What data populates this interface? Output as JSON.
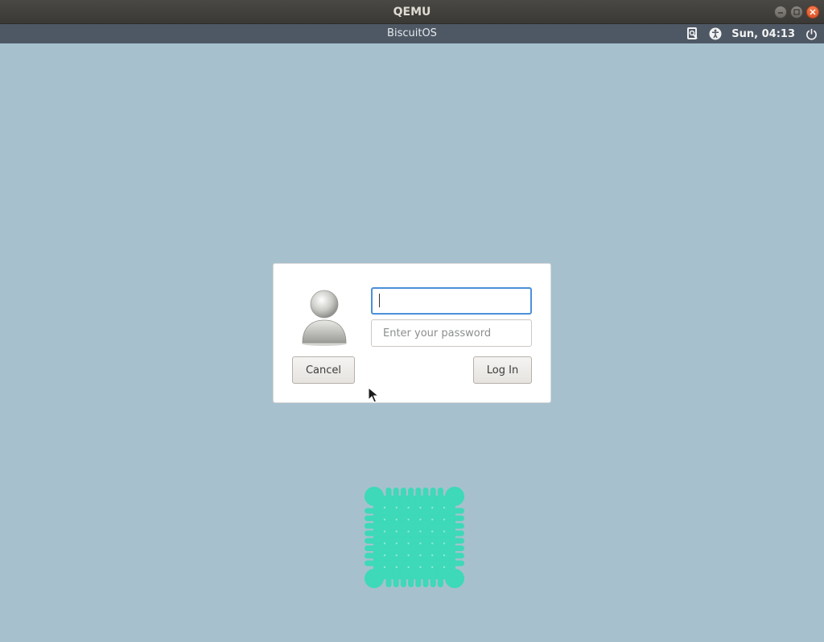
{
  "window": {
    "title": "QEMU",
    "buttons": [
      "minimize",
      "maximize",
      "close"
    ]
  },
  "topbar": {
    "hostname": "BiscuitOS",
    "clock": "Sun, 04:13",
    "icons": [
      "screen-reader-icon",
      "accessibility-icon",
      "power-icon"
    ]
  },
  "login": {
    "username_value": "",
    "password_placeholder": "Enter your password",
    "cancel_label": "Cancel",
    "login_label": "Log In"
  },
  "colors": {
    "background": "#a6c1cd",
    "topbar": "#4e5865",
    "focus": "#4a90d9",
    "logo": "#3dd9b8"
  }
}
